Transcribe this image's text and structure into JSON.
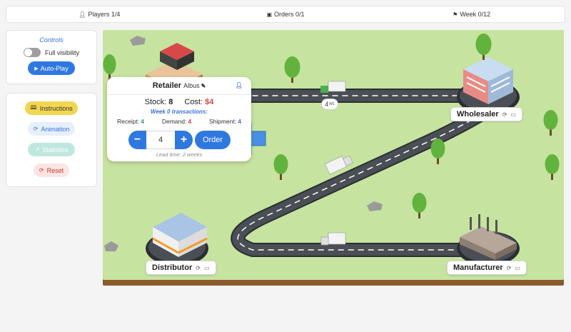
{
  "topbar": {
    "players": "Players 1/4",
    "orders": "Orders 0/1",
    "week": "Week 0/12"
  },
  "controls": {
    "title": "Controls",
    "full_visibility": "Full visibility",
    "autoplay": "Auto-Play"
  },
  "actions": {
    "instructions": "Instructions",
    "animation": "Animation",
    "statistics": "Statistics",
    "reset": "Reset"
  },
  "nodes": {
    "wholesaler": "Wholesaler",
    "distributor": "Distributor",
    "manufacturer": "Manufacturer"
  },
  "truck_badge": {
    "count": "4",
    "week": "W1"
  },
  "retailer": {
    "title": "Retailer",
    "player": "Albus",
    "stock_label": "Stock:",
    "stock_value": "8",
    "cost_label": "Cost:",
    "cost_value": "$4",
    "week_title": "Week 0 transactions:",
    "receipt_label": "Receipt:",
    "receipt_value": "4",
    "demand_label": "Demand:",
    "demand_value": "4",
    "shipment_label": "Shipment:",
    "shipment_value": "4",
    "order_qty": "4",
    "order_button": "Order",
    "minus": "−",
    "plus": "+",
    "lead_time": "Lead time: 2 weeks"
  },
  "colors": {
    "accent": "#2f78e0",
    "grass": "#c6e3a0",
    "road": "#4a4f55",
    "cost": "#e04040",
    "receipt": "#2a9d8f"
  },
  "icons": [
    "person-icon",
    "box-icon",
    "flag-icon",
    "play-icon",
    "book-icon",
    "refresh-icon",
    "chart-icon",
    "monitor-icon",
    "pencil-icon"
  ]
}
